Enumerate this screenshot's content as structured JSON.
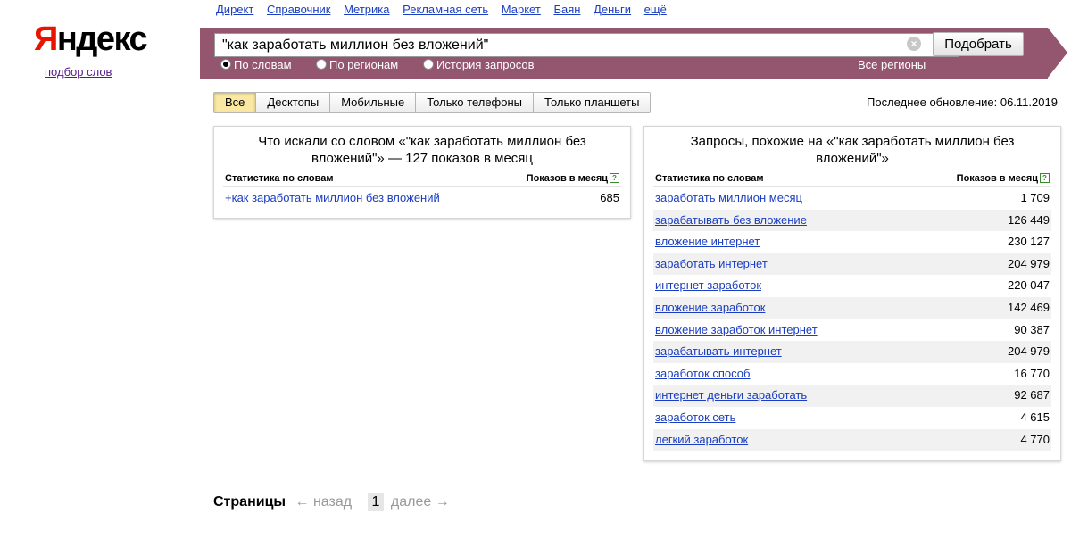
{
  "logo": {
    "text_first": "Я",
    "text_rest": "ндекс",
    "subtitle": "подбор слов"
  },
  "nav": [
    "Директ",
    "Справочник",
    "Метрика",
    "Рекламная сеть",
    "Маркет",
    "Баян",
    "Деньги",
    "ещё"
  ],
  "search": {
    "value": "\"как заработать миллион без вложений\"",
    "button": "Подобрать",
    "modes": [
      "По словам",
      "По регионам",
      "История запросов"
    ],
    "selected_mode": 0,
    "regions_link": "Все регионы"
  },
  "tabs": {
    "items": [
      "Все",
      "Десктопы",
      "Мобильные",
      "Только телефоны",
      "Только планшеты"
    ],
    "active": 0
  },
  "last_update": "Последнее обновление: 06.11.2019",
  "left_panel": {
    "title": "Что искали со словом «\"как заработать миллион без вложений\"» — 127 показов в месяц",
    "col_stats": "Статистика по словам",
    "col_shows": "Показов в месяц",
    "rows": [
      {
        "phrase": "+как заработать миллион без вложений",
        "count": "685"
      }
    ]
  },
  "right_panel": {
    "title": "Запросы, похожие на «\"как заработать миллион без вложений\"»",
    "col_stats": "Статистика по словам",
    "col_shows": "Показов в месяц",
    "rows": [
      {
        "phrase": "заработать миллион месяц",
        "count": "1 709"
      },
      {
        "phrase": "зарабатывать без вложение",
        "count": "126 449"
      },
      {
        "phrase": "вложение интернет",
        "count": "230 127"
      },
      {
        "phrase": "заработать интернет",
        "count": "204 979"
      },
      {
        "phrase": "интернет заработок",
        "count": "220 047"
      },
      {
        "phrase": "вложение заработок",
        "count": "142 469"
      },
      {
        "phrase": "вложение заработок интернет",
        "count": "90 387"
      },
      {
        "phrase": "зарабатывать интернет",
        "count": "204 979"
      },
      {
        "phrase": "заработок способ",
        "count": "16 770"
      },
      {
        "phrase": "интернет деньги заработать",
        "count": "92 687"
      },
      {
        "phrase": "заработок сеть",
        "count": "4 615"
      },
      {
        "phrase": "легкий заработок",
        "count": "4 770"
      }
    ]
  },
  "pager": {
    "title": "Страницы",
    "prev": "← назад",
    "current": "1",
    "next": "далее →"
  },
  "icons": {
    "clear": "clear-icon",
    "help": "help-icon"
  },
  "colors": {
    "band": "#94556e",
    "link": "#1a3dc1",
    "logo_red": "#e61400",
    "active_tab": "#fbe9a3"
  }
}
